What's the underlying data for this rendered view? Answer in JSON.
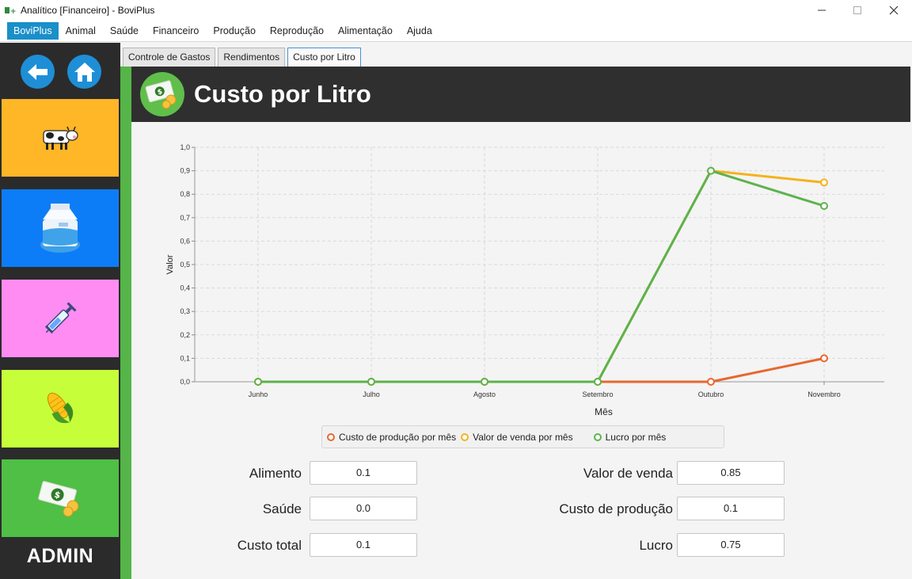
{
  "window": {
    "title": "Analítico [Financeiro] - BoviPlus",
    "controls": [
      "minimize",
      "maximize",
      "close"
    ]
  },
  "menu": {
    "items": [
      {
        "label": "BoviPlus",
        "active": true
      },
      {
        "label": "Animal"
      },
      {
        "label": "Saúde"
      },
      {
        "label": "Financeiro"
      },
      {
        "label": "Produção"
      },
      {
        "label": "Reprodução"
      },
      {
        "label": "Alimentação"
      },
      {
        "label": "Ajuda"
      }
    ]
  },
  "sidebar": {
    "back_icon": "arrow-left-icon",
    "home_icon": "home-icon",
    "tiles": [
      {
        "name": "animal",
        "icon": "cow-icon",
        "color": "#ffb627"
      },
      {
        "name": "producao",
        "icon": "milk-carton-icon",
        "color": "#0d7df7"
      },
      {
        "name": "saude",
        "icon": "syringe-icon",
        "color": "#ff8cf2"
      },
      {
        "name": "alimentacao",
        "icon": "corn-icon",
        "color": "#c6ff3a"
      },
      {
        "name": "financeiro",
        "icon": "money-icon",
        "color": "#4fbf45"
      }
    ],
    "user_label": "ADMIN"
  },
  "tabs": [
    {
      "label": "Controle de Gastos"
    },
    {
      "label": "Rendimentos"
    },
    {
      "label": "Custo por Litro",
      "selected": true
    }
  ],
  "header": {
    "title": "Custo por Litro",
    "icon": "money-icon"
  },
  "chart_data": {
    "type": "line",
    "xlabel": "Mês",
    "ylabel": "Valor",
    "categories": [
      "Junho",
      "Julho",
      "Agosto",
      "Setembro",
      "Outubro",
      "Novembro"
    ],
    "ylim": [
      0,
      1.0
    ],
    "yticks": [
      "0,0",
      "0,1",
      "0,2",
      "0,3",
      "0,4",
      "0,5",
      "0,6",
      "0,7",
      "0,8",
      "0,9",
      "1,0"
    ],
    "grid": true,
    "legend_position": "bottom",
    "series": [
      {
        "name": "Custo de produção por mês",
        "color": "#e8672e",
        "values": [
          0,
          0,
          0,
          0,
          0,
          0.1
        ]
      },
      {
        "name": "Valor de venda por mês",
        "color": "#f5b21c",
        "values": [
          0,
          0,
          0,
          0,
          0.9,
          0.85
        ]
      },
      {
        "name": "Lucro por mês",
        "color": "#5cb34c",
        "values": [
          0,
          0,
          0,
          0,
          0.9,
          0.75
        ]
      }
    ]
  },
  "fields": {
    "alimento": {
      "label": "Alimento",
      "value": "0.1"
    },
    "saude": {
      "label": "Saúde",
      "value": "0.0"
    },
    "custo_total": {
      "label": "Custo total",
      "value": "0.1"
    },
    "valor_venda": {
      "label": "Valor de venda",
      "value": "0.85"
    },
    "custo_producao": {
      "label": "Custo de produção",
      "value": "0.1"
    },
    "lucro": {
      "label": "Lucro",
      "value": "0.75"
    }
  }
}
